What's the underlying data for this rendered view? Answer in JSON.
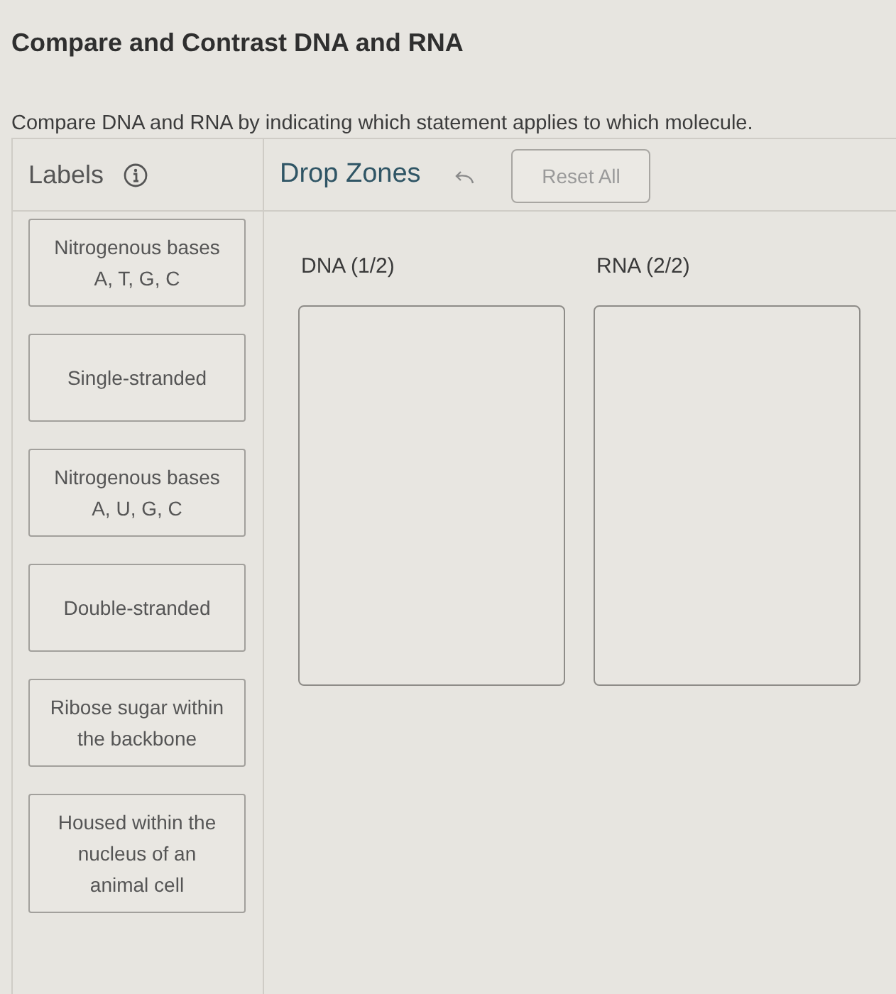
{
  "title": "Compare and Contrast DNA and RNA",
  "instructions": "Compare DNA and RNA by indicating which statement applies to which molecule.",
  "labels": {
    "heading": "Labels",
    "cards": [
      {
        "text": "Nitrogenous bases\nA, T, G, C"
      },
      {
        "text": "Single-stranded"
      },
      {
        "text": "Nitrogenous bases\nA, U, G, C"
      },
      {
        "text": "Double-stranded"
      },
      {
        "text": "Ribose sugar within\nthe backbone"
      },
      {
        "text": "Housed within the\nnucleus of an\nanimal cell"
      }
    ]
  },
  "drop_zones": {
    "heading": "Drop Zones",
    "reset_button": "Reset All",
    "zones": [
      {
        "heading": "DNA (1/2)"
      },
      {
        "heading": "RNA (2/2)"
      }
    ]
  }
}
